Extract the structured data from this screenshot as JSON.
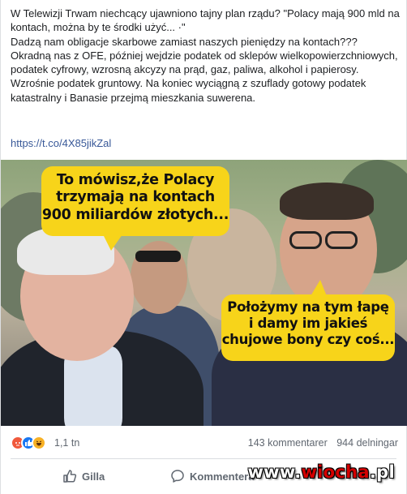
{
  "post": {
    "text_lines": [
      "W Telewizji Trwam niechcący ujawniono tajny plan rządu? \"Polacy mają 900 mld na kontach, można by te środki użyć... ·\"",
      "Dadzą nam obligacje skarbowe zamiast naszych pieniędzy na kontach???",
      "Okradną nas z OFE, później wejdzie podatek od sklepów wielkopowierzchniowych, podatek cyfrowy, wzrosną akcyzy na prąd, gaz, paliwa, alkohol i papierosy. Wzrośnie podatek gruntowy. Na koniec wyciągną z szuflady gotowy podatek katastralny i Banasie przejmą mieszkania suwerena."
    ],
    "link": "https://t.co/4X85jikZal"
  },
  "image": {
    "bubble_top_lines": [
      "To mówisz,że Polacy",
      "trzymają na kontach",
      "900 miliardów złotych..."
    ],
    "bubble_bottom_lines": [
      "Położymy na tym łapę",
      "i damy im jakieś",
      "chujowe bony czy coś..."
    ]
  },
  "stats": {
    "reaction_icons": [
      "angry-icon",
      "like-icon",
      "haha-icon"
    ],
    "reactions_count": "1,1 tn",
    "comments": "143 kommentarer",
    "shares": "944 delningar"
  },
  "actions": {
    "like_label": "Gilla",
    "comment_label": "Kommentera"
  },
  "watermark": {
    "prefix": "www.",
    "brand": "wiocha",
    "suffix": ".pl"
  },
  "colors": {
    "bubble": "#f7d41a",
    "link": "#385898",
    "like_blue": "#1877f2",
    "angry": "#f0593c",
    "haha": "#f7b125",
    "watermark_red": "#d40000"
  }
}
